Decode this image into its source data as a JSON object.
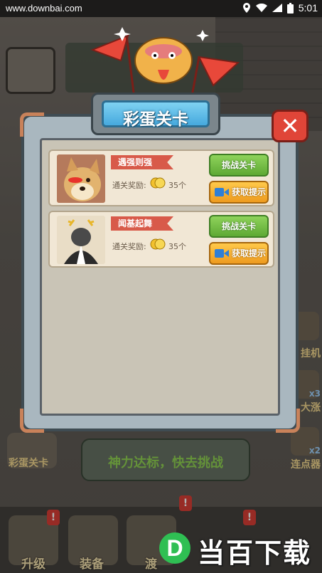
{
  "status_bar": {
    "url": "www.downbai.com",
    "time": "5:01"
  },
  "dialog": {
    "title": "彩蛋关卡",
    "close_symbol": "✕",
    "levels": [
      {
        "name": "遇强则强",
        "reward_label": "通关奖励:",
        "reward_amount": "35个",
        "challenge_label": "挑战关卡",
        "hint_label": "获取提示"
      },
      {
        "name": "闻基起舞",
        "reward_label": "通关奖励:",
        "reward_amount": "35个",
        "challenge_label": "挑战关卡",
        "hint_label": "获取提示"
      }
    ]
  },
  "toast": {
    "message": "神力达标，快去挑战"
  },
  "background": {
    "left_button_label": "彩蛋关卡",
    "side_labels": [
      "挂机",
      "大涨",
      "连点器"
    ],
    "side_multipliers": [
      "x3",
      "x2"
    ],
    "nav_labels": [
      "升级",
      "装备",
      "渡"
    ],
    "badge_symbol": "!"
  },
  "watermark": {
    "logo_letter": "D",
    "text": "当百下载"
  },
  "colors": {
    "title_blue": "#46a9de",
    "challenge_green": "#5ea934",
    "hint_orange": "#ee9b1f",
    "ribbon_red": "#d85a4a",
    "close_red": "#e04538"
  }
}
